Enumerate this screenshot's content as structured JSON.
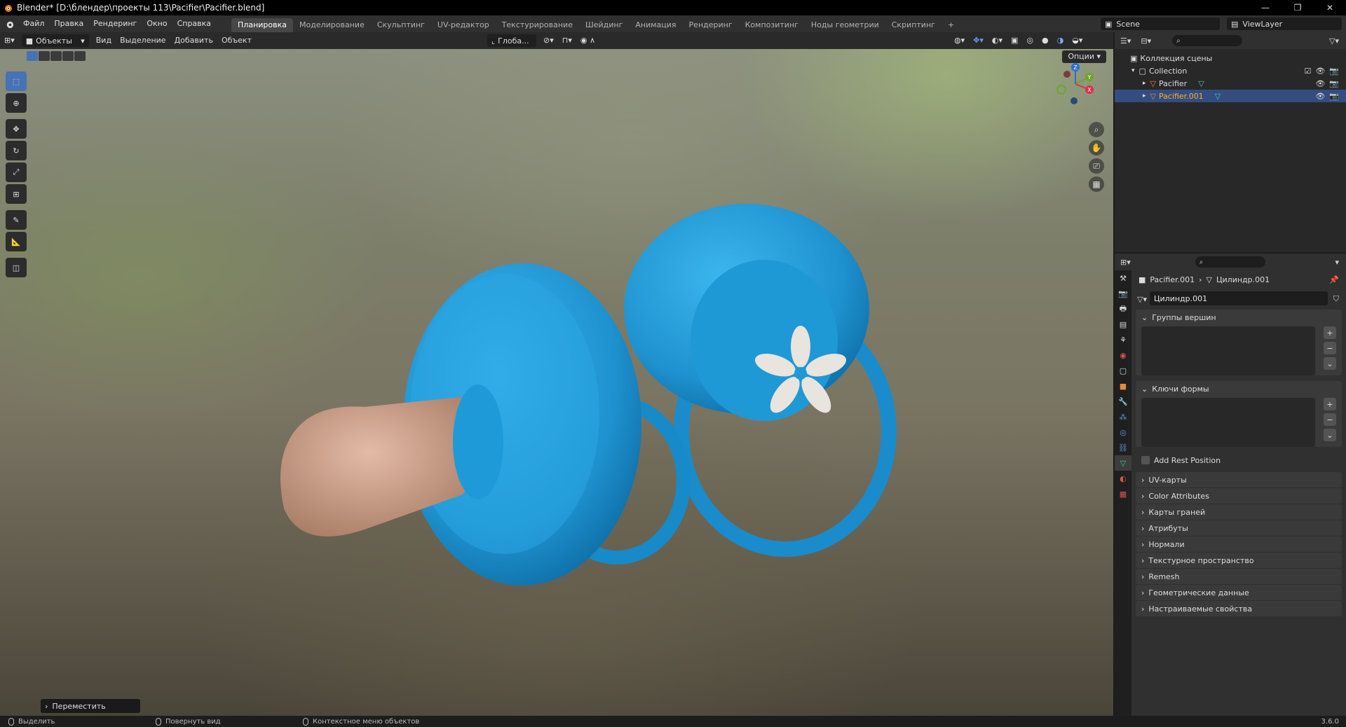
{
  "window": {
    "title": "Blender* [D:\\блендер\\проекты 113\\Pacifier\\Pacifier.blend]",
    "minimize": "—",
    "maximize": "❐",
    "close": "✕"
  },
  "menu": {
    "items": [
      "Файл",
      "Правка",
      "Рендеринг",
      "Окно",
      "Справка"
    ]
  },
  "workspaces": {
    "tabs": [
      "Планировка",
      "Моделирование",
      "Скульптинг",
      "UV-редактор",
      "Текстурирование",
      "Шейдинг",
      "Анимация",
      "Рендеринг",
      "Композитинг",
      "Ноды геометрии",
      "Скриптинг"
    ],
    "active": "Планировка",
    "add": "+"
  },
  "scene": {
    "label": "Scene"
  },
  "viewlayer": {
    "label": "ViewLayer"
  },
  "viewport": {
    "mode": "Объекты",
    "menus": [
      "Вид",
      "Выделение",
      "Добавить",
      "Объект"
    ],
    "transform_orientation": "Глоба...",
    "options": "Опции",
    "last_operator": "Переместить"
  },
  "gizmo": {
    "x": "X",
    "y": "Y",
    "z": "Z"
  },
  "outliner": {
    "scene_collection": "Коллекция сцены",
    "collection": "Collection",
    "objects": [
      {
        "name": "Pacifier",
        "selected": false
      },
      {
        "name": "Pacifier.001",
        "selected": true
      }
    ]
  },
  "properties": {
    "breadcrumb_object": "Pacifier.001",
    "breadcrumb_mesh": "Цилиндр.001",
    "mesh_name": "Цилиндр.001",
    "panels": {
      "vertex_groups": "Группы вершин",
      "shape_keys": "Ключи формы",
      "add_rest_position": "Add Rest Position"
    },
    "collapsed_panels": [
      "UV-карты",
      "Color Attributes",
      "Карты граней",
      "Атрибуты",
      "Нормали",
      "Текстурное пространство",
      "Remesh",
      "Геометрические данные",
      "Настраиваемые свойства"
    ]
  },
  "status": {
    "select": "Выделить",
    "rotate": "Повернуть вид",
    "context": "Контекстное меню объектов",
    "version": "3.6.0"
  },
  "colors": {
    "accent": "#4772b3",
    "pacifier_blue": "#1e9ad6",
    "nipple": "#c99c86",
    "selected_row": "#334d80"
  }
}
